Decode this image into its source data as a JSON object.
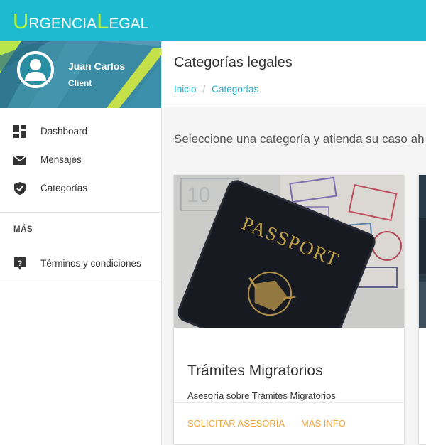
{
  "app": {
    "logo": {
      "letter1": "U",
      "part1": "RGENCIA",
      "letter2": "L",
      "part2": "EGAL"
    }
  },
  "sidebar": {
    "user": {
      "name": "Juan Carlos",
      "role": "Client"
    },
    "items": [
      {
        "label": "Dashboard",
        "icon": "dashboard-icon"
      },
      {
        "label": "Mensajes",
        "icon": "mail-icon"
      },
      {
        "label": "Categorías",
        "icon": "shield-check-icon"
      }
    ],
    "section_title": "MÁS",
    "extra_items": [
      {
        "label": "Términos y condiciones",
        "icon": "help-icon"
      }
    ]
  },
  "main": {
    "title": "Categorías legales",
    "breadcrumb": {
      "home": "Inicio",
      "separator": "/",
      "current": "Categorías"
    },
    "subtitle": "Seleccione una categoría y atienda su caso ah",
    "cards": [
      {
        "title": "Trámites Migratorios",
        "description": "Asesoría sobre Trámites Migratorios",
        "image_text": "PASSPORT",
        "actions": {
          "primary": "SOLICITAR ASESORÍA",
          "secondary": "MÁS INFO"
        }
      }
    ]
  },
  "colors": {
    "topbar": "#1ebbd0",
    "logo_accent": "#b6f53c",
    "link": "#1eaac4",
    "action": "#f0a33b"
  }
}
